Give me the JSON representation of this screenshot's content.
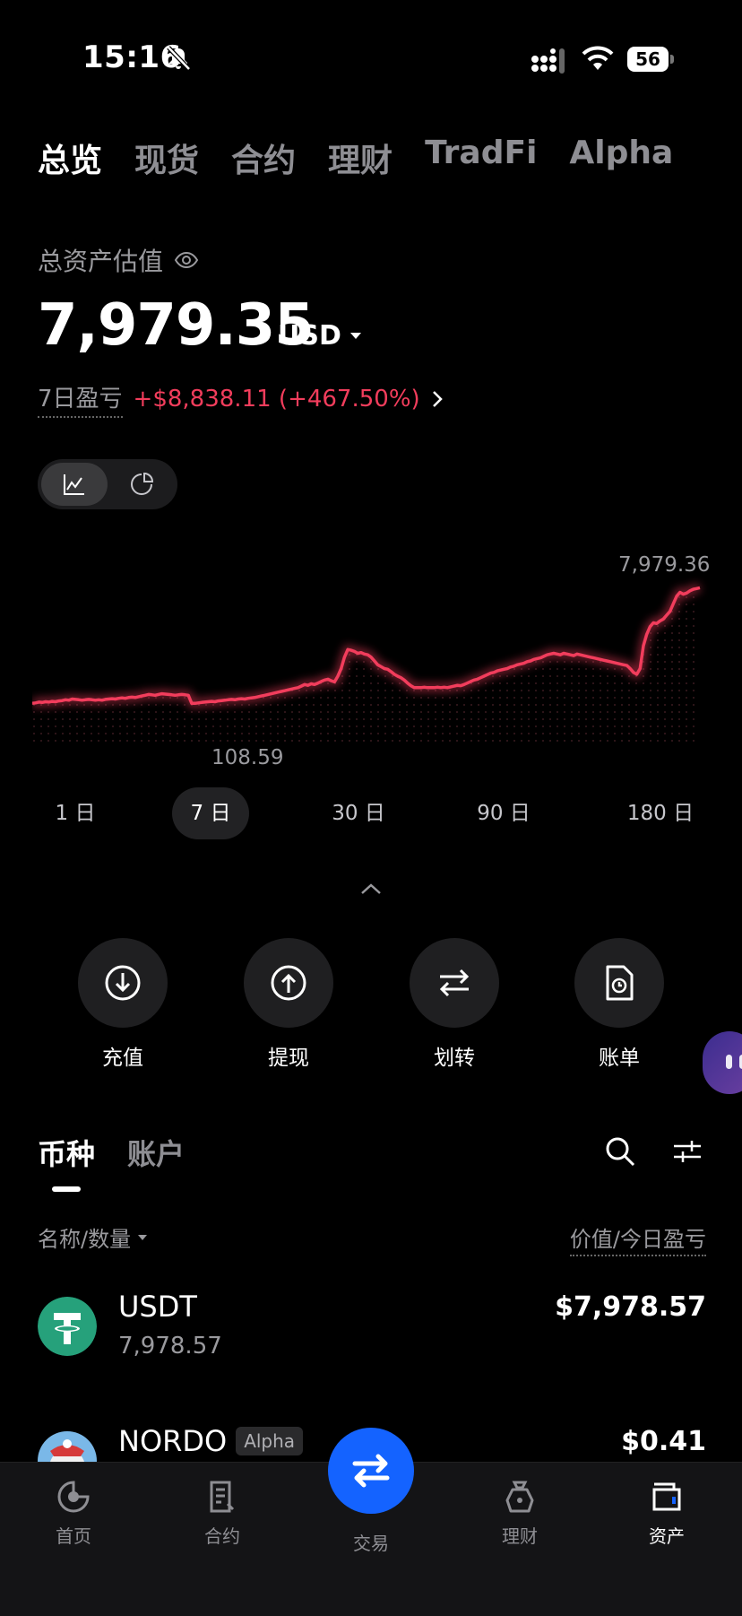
{
  "status_bar": {
    "time": "15:16",
    "battery": "56"
  },
  "tabs": [
    "总览",
    "现货",
    "合约",
    "理财",
    "TradFi",
    "Alpha"
  ],
  "summary": {
    "label": "总资产估值",
    "value": "7,979.35",
    "unit": "USD",
    "pnl_label": "7日盈亏",
    "pnl_value": "+$8,838.11 (+467.50%)"
  },
  "chart": {
    "high_label": "7,979.36",
    "low_label": "108.59",
    "line_color": "#f23d5c"
  },
  "chart_data": {
    "type": "line",
    "title": "",
    "xlabel": "",
    "ylabel": "",
    "values": [
      108.6,
      110,
      112,
      111,
      113,
      112,
      114,
      113,
      115,
      116,
      118,
      117,
      120,
      119,
      118,
      117,
      118,
      119,
      118,
      117,
      118,
      117,
      119,
      120,
      121,
      120,
      122,
      123,
      122,
      124,
      125,
      124,
      126,
      128,
      130,
      132,
      131,
      130,
      132,
      134,
      133,
      132,
      131,
      130,
      131,
      132,
      131,
      130,
      108.59,
      108.6,
      110,
      111,
      112,
      113,
      114,
      113,
      115,
      116,
      117,
      118,
      119,
      118,
      120,
      121,
      120,
      122,
      123,
      124,
      126,
      128,
      130,
      132,
      134,
      136,
      138,
      140,
      142,
      144,
      146,
      148,
      150,
      154,
      158,
      156,
      160,
      158,
      162,
      166,
      170,
      172,
      168,
      165,
      180,
      200,
      230,
      250,
      248,
      245,
      240,
      242,
      238,
      236,
      230,
      220,
      210,
      205,
      200,
      198,
      192,
      185,
      180,
      176,
      170,
      162,
      155,
      150,
      150,
      150,
      151,
      150,
      150,
      150,
      151,
      150,
      151,
      150,
      152,
      154,
      156,
      155,
      158,
      162,
      166,
      170,
      172,
      176,
      180,
      184,
      188,
      190,
      194,
      196,
      198,
      200,
      204,
      206,
      210,
      212,
      214,
      218,
      220,
      224,
      226,
      228,
      232,
      236,
      238,
      240,
      238,
      236,
      240,
      238,
      236,
      234,
      238,
      236,
      234,
      232,
      230,
      228,
      226,
      224,
      222,
      220,
      218,
      216,
      214,
      212,
      210,
      208,
      200,
      190,
      185,
      200,
      260,
      290,
      310,
      320,
      318,
      325,
      330,
      340,
      350,
      370,
      390,
      400,
      395,
      398,
      404,
      408,
      410,
      412
    ],
    "ylim": [
      100,
      420
    ],
    "grid": false,
    "series": [
      {
        "values": []
      }
    ]
  },
  "ranges": [
    "1 日",
    "7 日",
    "30 日",
    "90 日",
    "180 日"
  ],
  "selected_range": "7 日",
  "actions": [
    "充值",
    "提现",
    "划转",
    "账单"
  ],
  "asset_tabs": [
    "币种",
    "账户"
  ],
  "columns": {
    "left": "名称/数量",
    "right": "价值/今日盈亏"
  },
  "assets": [
    {
      "name": "USDT",
      "amount": "7,978.57",
      "value": "$7,978.57"
    },
    {
      "name": "NORDO",
      "badge": "Alpha",
      "value": "$0.41"
    }
  ],
  "nav": [
    "首页",
    "合约",
    "交易",
    "理财",
    "资产"
  ],
  "colors": {
    "accent": "#1463ff",
    "loss_gain": "#f23d5c",
    "usdt": "#26a17b"
  }
}
